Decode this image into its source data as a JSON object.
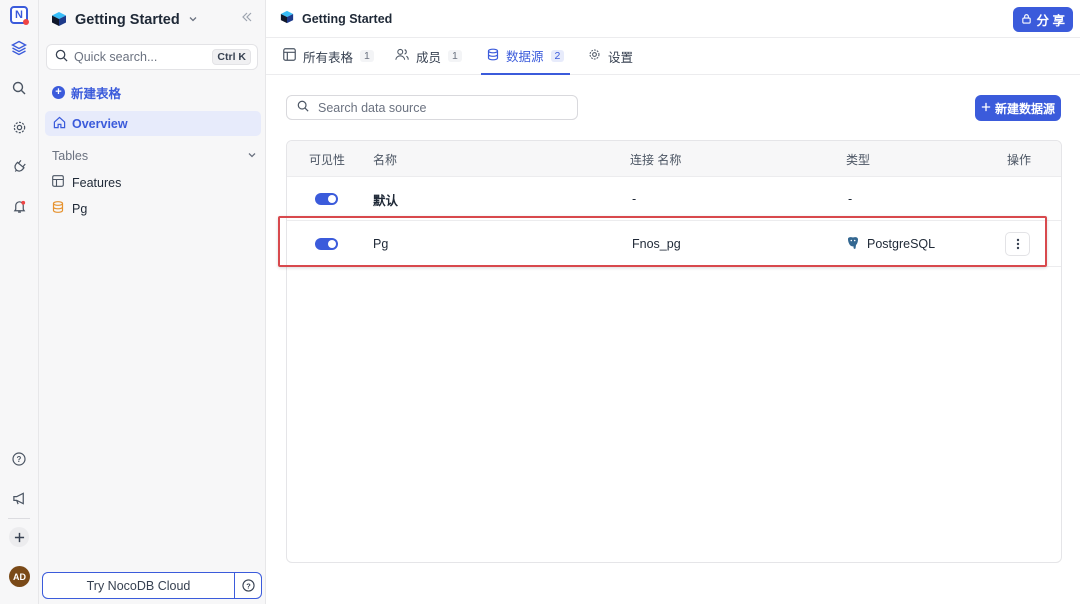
{
  "rail": {
    "icons": [
      "nocodb-logo-icon",
      "layers-icon",
      "search-icon",
      "gear-icon",
      "plug-icon",
      "bell-icon",
      "help-icon",
      "megaphone-icon",
      "plus-icon"
    ],
    "avatar": "AD"
  },
  "sidebar": {
    "workspace_title": "Getting Started",
    "search_placeholder": "Quick search...",
    "search_shortcut": "Ctrl K",
    "new_table_label": "新建表格",
    "overview_label": "Overview",
    "tables_header": "Tables",
    "tables": [
      {
        "label": "Features",
        "icon": "grid-icon"
      },
      {
        "label": "Pg",
        "icon": "database-icon"
      }
    ],
    "try_cloud_label": "Try NocoDB Cloud"
  },
  "topbar": {
    "title": "Getting Started",
    "share_label": "分 享"
  },
  "tabs": [
    {
      "label": "所有表格",
      "count": "1",
      "icon": "table-icon"
    },
    {
      "label": "成员",
      "count": "1",
      "icon": "users-icon"
    },
    {
      "label": "数据源",
      "count": "2",
      "icon": "database-icon",
      "active": true
    },
    {
      "label": "设置",
      "icon": "gear-icon"
    }
  ],
  "datasources": {
    "search_placeholder": "Search data source",
    "new_button_label": "新建数据源",
    "columns": [
      "可见性",
      "名称",
      "连接 名称",
      "类型",
      "操作"
    ],
    "rows": [
      {
        "visible": true,
        "name": "默认",
        "connection": "-",
        "type": "-"
      },
      {
        "visible": true,
        "name": "Pg",
        "connection": "Fnos_pg",
        "type": "PostgreSQL",
        "type_icon": "postgresql-icon"
      }
    ]
  },
  "colors": {
    "accent": "#3b5bdb",
    "highlight": "#d8494d"
  }
}
